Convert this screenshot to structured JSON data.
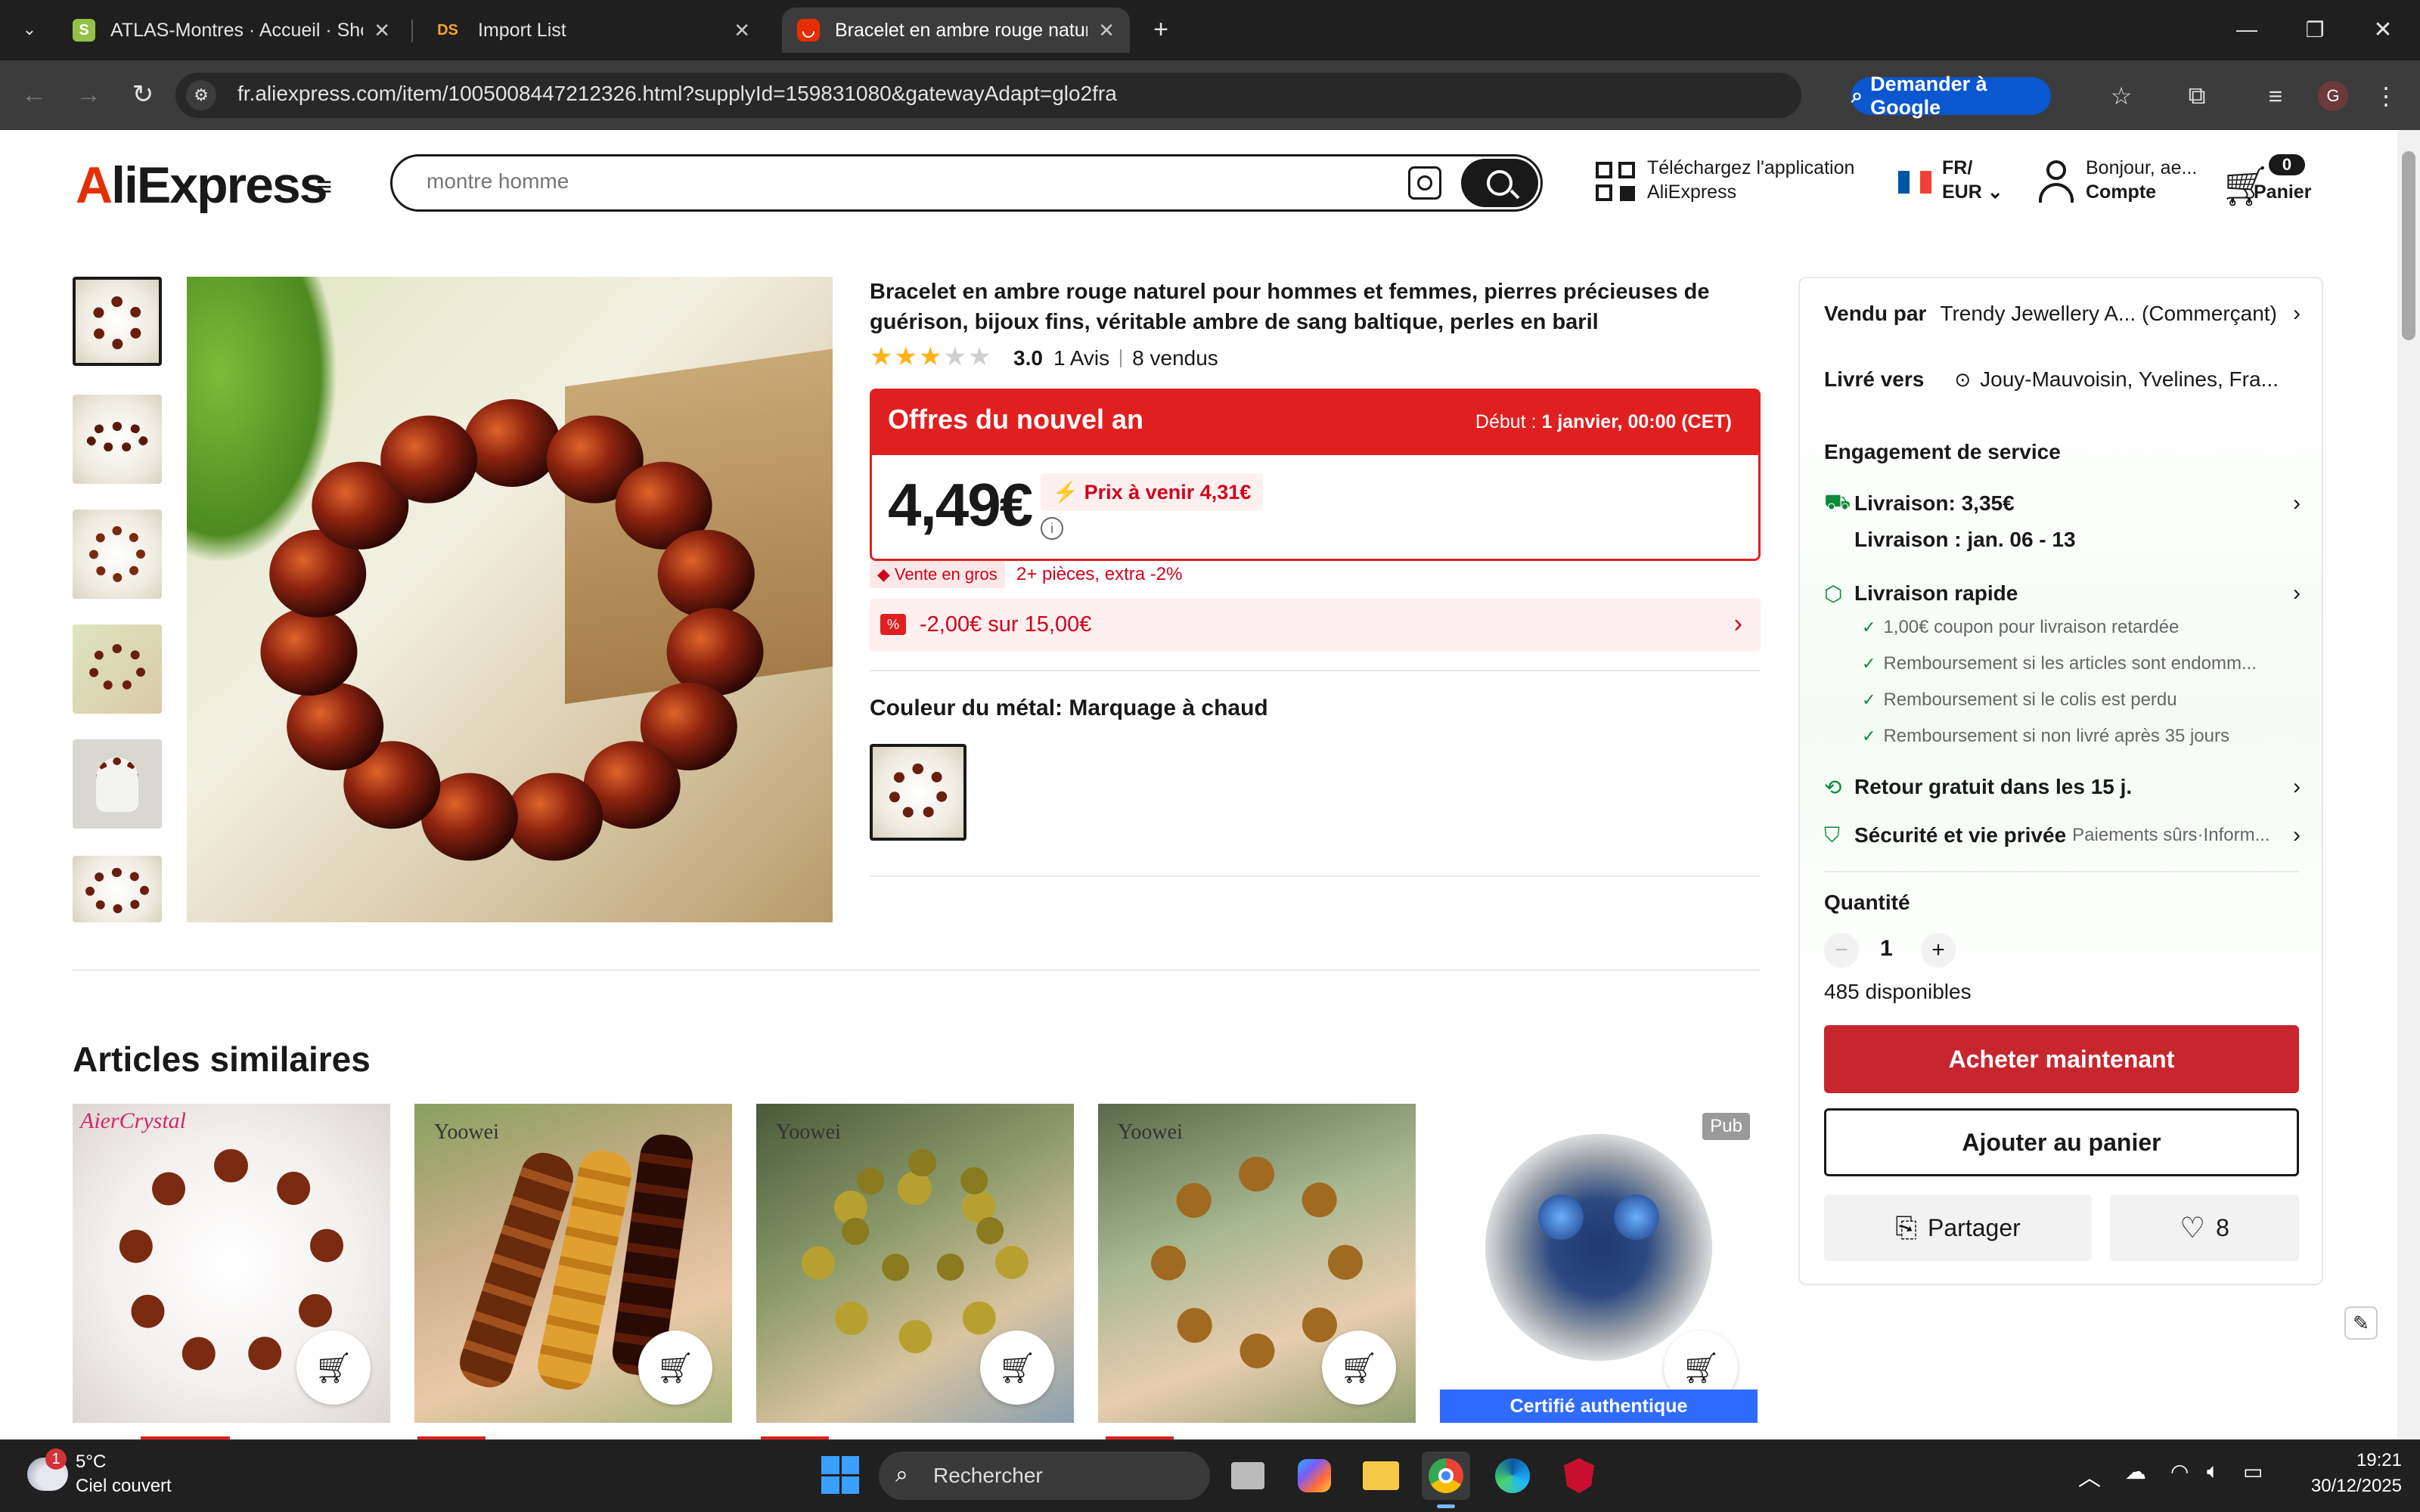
{
  "browser": {
    "tabs": [
      {
        "title": "ATLAS-Montres · Accueil · Shop",
        "favicon": "shopify-icon"
      },
      {
        "title": "Import List",
        "favicon": "ds-icon"
      },
      {
        "title": "Bracelet en ambre rouge naturel",
        "favicon": "aliexpress-icon"
      }
    ],
    "url": "fr.aliexpress.com/item/1005008447212326.html?supplyId=159831080&gatewayAdapt=glo2fra",
    "ask_google": "Demander à Google",
    "profile_initial": "G",
    "ds_label": "DS"
  },
  "header": {
    "logo_left": "A",
    "logo_rest": "liExpress",
    "search_placeholder": "montre homme",
    "app_line1": "Téléchargez l'application",
    "app_line2": "AliExpress",
    "lang": "FR/",
    "currency": "EUR",
    "greeting": "Bonjour, ae...",
    "account": "Compte",
    "cart_count": "0",
    "cart_label": "Panier"
  },
  "product": {
    "title": "Bracelet en ambre rouge naturel pour hommes et femmes, pierres précieuses de guérison, bijoux fins, véritable ambre de sang baltique, perles en baril",
    "rating_value": 3,
    "rating": "3.0",
    "reviews": "1 Avis",
    "sold": "8 vendus",
    "promo_title": "Offres du nouvel an",
    "promo_start_label": "Début :",
    "promo_start": "1 janvier, 00:00 (CET)",
    "price": "4,49€",
    "future_price": "Prix à venir 4,31€",
    "wholesale_badge": "Vente en gros",
    "wholesale_offer": "2+ pièces, extra -2%",
    "coupon": "-2,00€ sur 15,00€",
    "color_label": "Couleur du métal: Marquage à chaud"
  },
  "side": {
    "sold_by_label": "Vendu par",
    "sold_by": "Trendy Jewellery A... (Commerçant)",
    "ship_to_label": "Livré vers",
    "ship_to": "Jouy-Mauvoisin, Yvelines, Fra...",
    "service_title": "Engagement de service",
    "delivery_price": "Livraison: 3,35€",
    "delivery_date": "Livraison : jan. 06 - 13",
    "fast_delivery": "Livraison rapide",
    "guarantees": [
      "1,00€ coupon pour livraison retardée",
      "Remboursement si les articles sont endomm...",
      "Remboursement si le colis est perdu",
      "Remboursement si non livré après 35 jours"
    ],
    "free_return": "Retour gratuit dans les 15 j.",
    "security": "Sécurité et vie privée",
    "security_sub": "Paiements sûrs·Inform...",
    "qty_label": "Quantité",
    "qty": "1",
    "stock": "485 disponibles",
    "buy_now": "Acheter maintenant",
    "add_cart": "Ajouter au panier",
    "share": "Partager",
    "wish_count": "8"
  },
  "similar": {
    "title": "Articles similaires",
    "cards": [
      {
        "brand": "AierCrystal",
        "badge": ""
      },
      {
        "brand": "Yoowei",
        "badge": ""
      },
      {
        "brand": "Yoowei",
        "badge": ""
      },
      {
        "brand": "Yoowei",
        "badge": ""
      },
      {
        "brand": "",
        "badge": "Pub",
        "footer": "Certifié authentique"
      }
    ]
  },
  "taskbar": {
    "weather_temp": "5°C",
    "weather_desc": "Ciel couvert",
    "weather_badge": "1",
    "search": "Rechercher",
    "time": "19:21",
    "date": "30/12/2025"
  },
  "colors": {
    "accent_red": "#e02020",
    "buy_red": "#c8262f",
    "star": "#fdb216",
    "chrome_dark": "#1f1f1f",
    "google_blue": "#0b57d0"
  }
}
